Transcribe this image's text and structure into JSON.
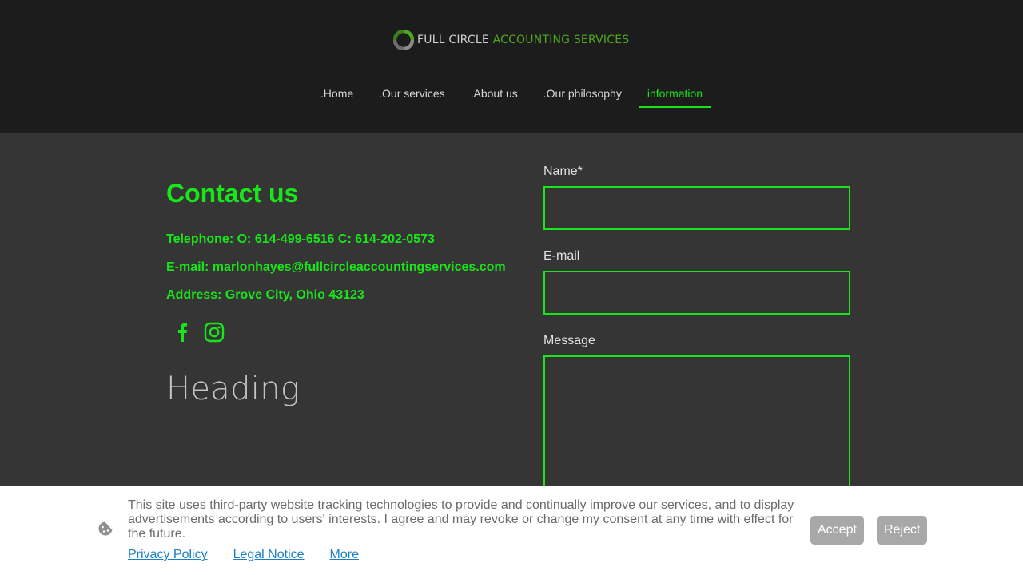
{
  "header": {
    "logo_part1": "FULL CIRCLE",
    "logo_part2": "ACCOUNTING SERVICES",
    "nav": [
      {
        "label": ".Home"
      },
      {
        "label": ".Our services"
      },
      {
        "label": ".About us"
      },
      {
        "label": ".Our philosophy"
      },
      {
        "label": "information",
        "active": true
      }
    ]
  },
  "contact": {
    "title": "Contact us",
    "telephone": "Telephone: O: 614-499-6516 C: 614-202-0573",
    "email": "E-mail: marlonhayes@fullcircleaccountingservices.com",
    "address": "Address: Grove City, Ohio 43123",
    "social_icons": [
      "facebook-icon",
      "instagram-icon"
    ],
    "heading": "Heading"
  },
  "form": {
    "name_label": "Name*",
    "name_value": "",
    "email_label": "E-mail",
    "email_value": "",
    "message_label": "Message",
    "message_value": ""
  },
  "cookie_banner": {
    "text": "This site uses third-party website tracking technologies to provide and continually improve our services, and to display advertisements according to users' interests. I agree and may revoke or change my consent at any time with effect for the future.",
    "links": [
      "Privacy Policy",
      "Legal Notice",
      "More"
    ],
    "accept_label": "Accept",
    "reject_label": "Reject",
    "icon": "cookie-icon"
  },
  "colors": {
    "accent_green": "#19e619",
    "logo_green": "#4ea81e",
    "header_bg": "#1c1c1c",
    "body_bg": "#353535",
    "button_gray": "#a8a8a8",
    "link_blue": "#1c7fc4"
  }
}
